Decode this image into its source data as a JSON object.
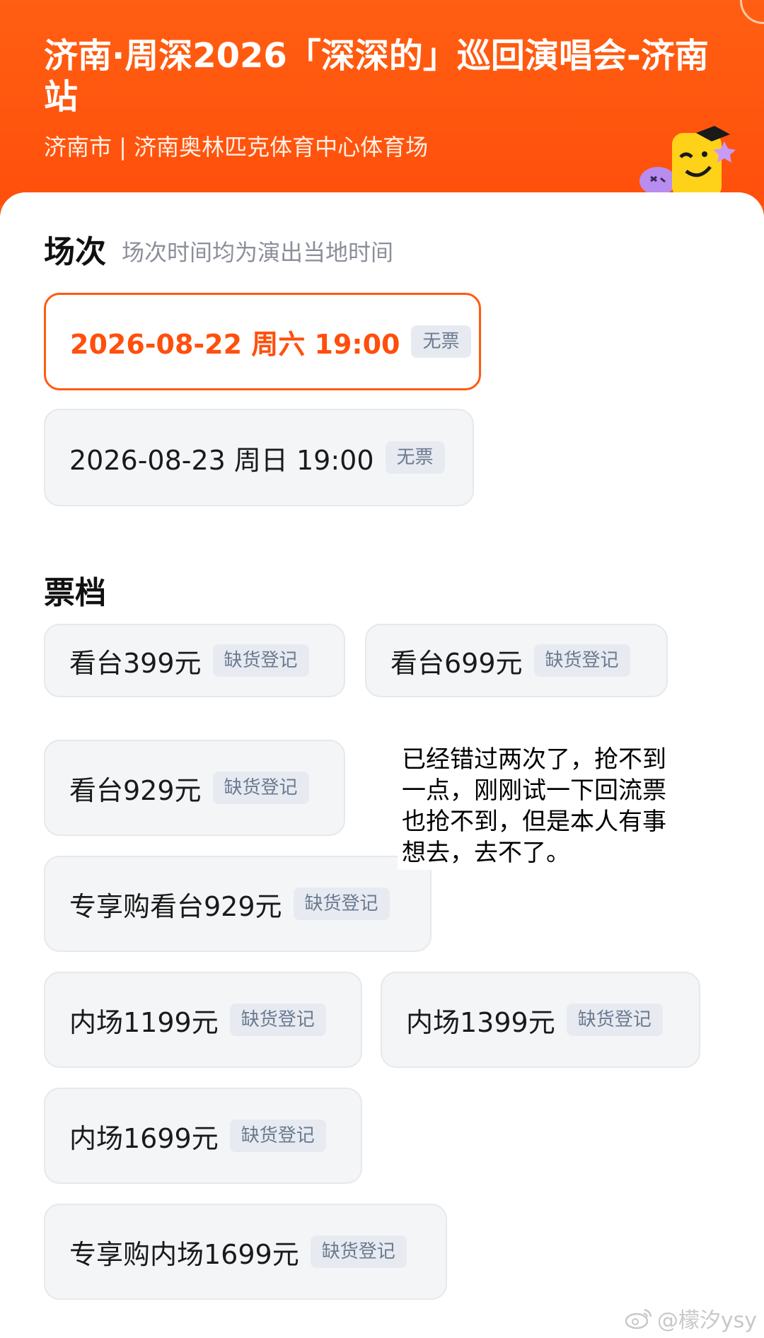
{
  "header": {
    "title": "济南·周深2026「深深的」巡回演唱会-济南站",
    "venue": "济南市 | 济南奥林匹克体育中心体育场"
  },
  "sessions": {
    "title": "场次",
    "subtitle": "场次时间均为演出当地时间",
    "items": [
      {
        "label": "2026-08-22 周六 19:00",
        "badge": "无票"
      },
      {
        "label": "2026-08-23 周日 19:00",
        "badge": "无票"
      }
    ]
  },
  "tiers": {
    "title": "票档",
    "items": [
      {
        "label": "看台399元",
        "badge": "缺货登记"
      },
      {
        "label": "看台699元",
        "badge": "缺货登记"
      },
      {
        "label": "看台929元",
        "badge": "缺货登记"
      },
      {
        "label": "专享购看台929元",
        "badge": "缺货登记"
      },
      {
        "label": "内场1199元",
        "badge": "缺货登记"
      },
      {
        "label": "内场1399元",
        "badge": "缺货登记"
      },
      {
        "label": "内场1699元",
        "badge": "缺货登记"
      },
      {
        "label": "专享购内场1699元",
        "badge": "缺货登记"
      }
    ]
  },
  "note": "已经错过两次了，抢不到一点，刚刚试一下回流票也抢不到，但是本人有事想去，去不了。",
  "watermark": "@檬汐ysy",
  "colors": {
    "accent": "#ff5a12",
    "selected_text": "#ff4f0c",
    "badge_text": "#6b7a90"
  }
}
